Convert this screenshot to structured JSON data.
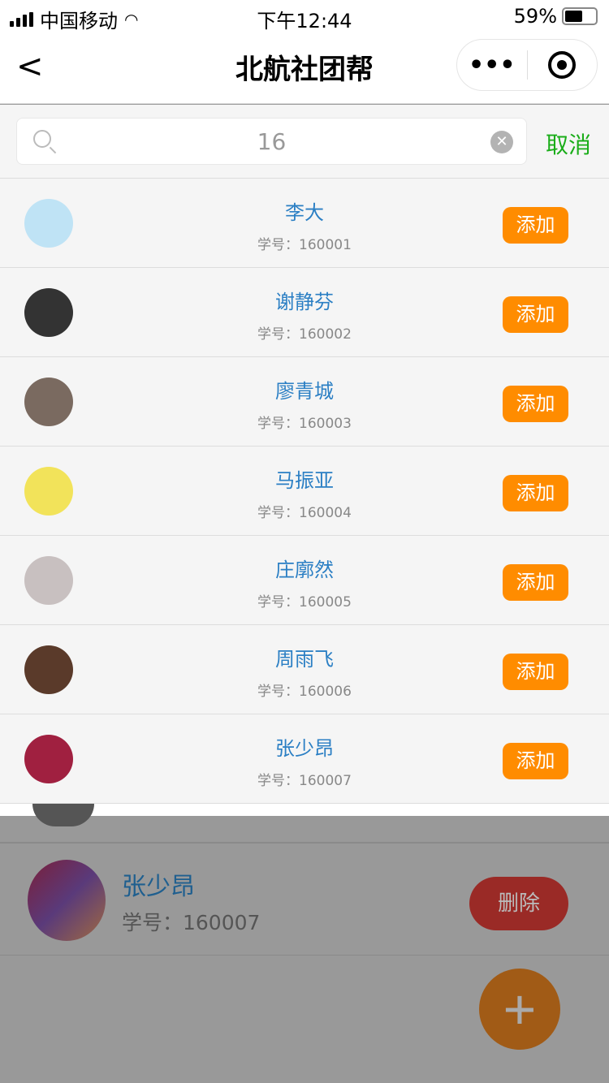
{
  "status": {
    "carrier": "中国移动",
    "time": "下午12:44",
    "battery": "59%",
    "battery_level": 0.59
  },
  "nav": {
    "title": "北航社团帮",
    "back_icon": "chevron-left-icon",
    "more_icon": "more-dots-icon",
    "close_icon": "target-icon",
    "more_label": "•••"
  },
  "search": {
    "value": "16",
    "cancel": "取消",
    "clear": "✕"
  },
  "results": [
    {
      "name": "李大",
      "id": "学号：160001",
      "color": "#bfe3f5"
    },
    {
      "name": "谢静芬",
      "id": "学号：160002",
      "color": "#333333"
    },
    {
      "name": "廖青城",
      "id": "学号：160003",
      "color": "#7a6a60"
    },
    {
      "name": "马振亚",
      "id": "学号：160004",
      "color": "#f2e35a"
    },
    {
      "name": "庄廓然",
      "id": "学号：160005",
      "color": "#c8c0c0"
    },
    {
      "name": "周雨飞",
      "id": "学号：160006",
      "color": "#5a3a2a"
    },
    {
      "name": "张少昂",
      "id": "学号：160007",
      "color": "#a02040"
    }
  ],
  "add_label": "添加",
  "background": {
    "member": {
      "name": "张少昂",
      "id": "学号：160007"
    },
    "delete_label": "删除",
    "fab_label": "+"
  },
  "colors": {
    "accent": "#ff8c00",
    "cancel": "#1aad19",
    "name": "#2b7fc4"
  }
}
